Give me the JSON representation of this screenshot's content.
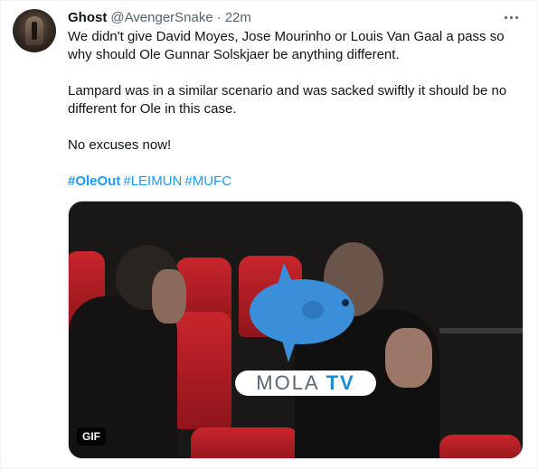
{
  "tweet": {
    "author_name": "Ghost",
    "handle": "@AvengerSnake",
    "separator": "·",
    "time": "22m",
    "paragraphs": [
      [
        "We didn't give David Moyes, Jose Mourinho or Louis Van Gaal a pass so",
        "why should Ole Gunnar Solskjaer be anything different."
      ],
      [
        "Lampard was in a similar scenario and was sacked swiftly it should be no",
        "different for Ole in this case."
      ],
      [
        "No excuses now!"
      ]
    ],
    "hashtags": [
      "#OleOut",
      "#LEIMUN",
      "#MUFC"
    ]
  },
  "media": {
    "watermark_left": "MOLA",
    "watermark_right": "TV",
    "badge": "GIF"
  },
  "icons": {
    "more": "more-horizontal-icon",
    "watermark": "mola-fish-icon"
  },
  "colors": {
    "link": "#1d9bf0",
    "secondary_text": "#536471",
    "seat_red": "#c9252c",
    "watermark_blue": "#3a8fd8"
  }
}
